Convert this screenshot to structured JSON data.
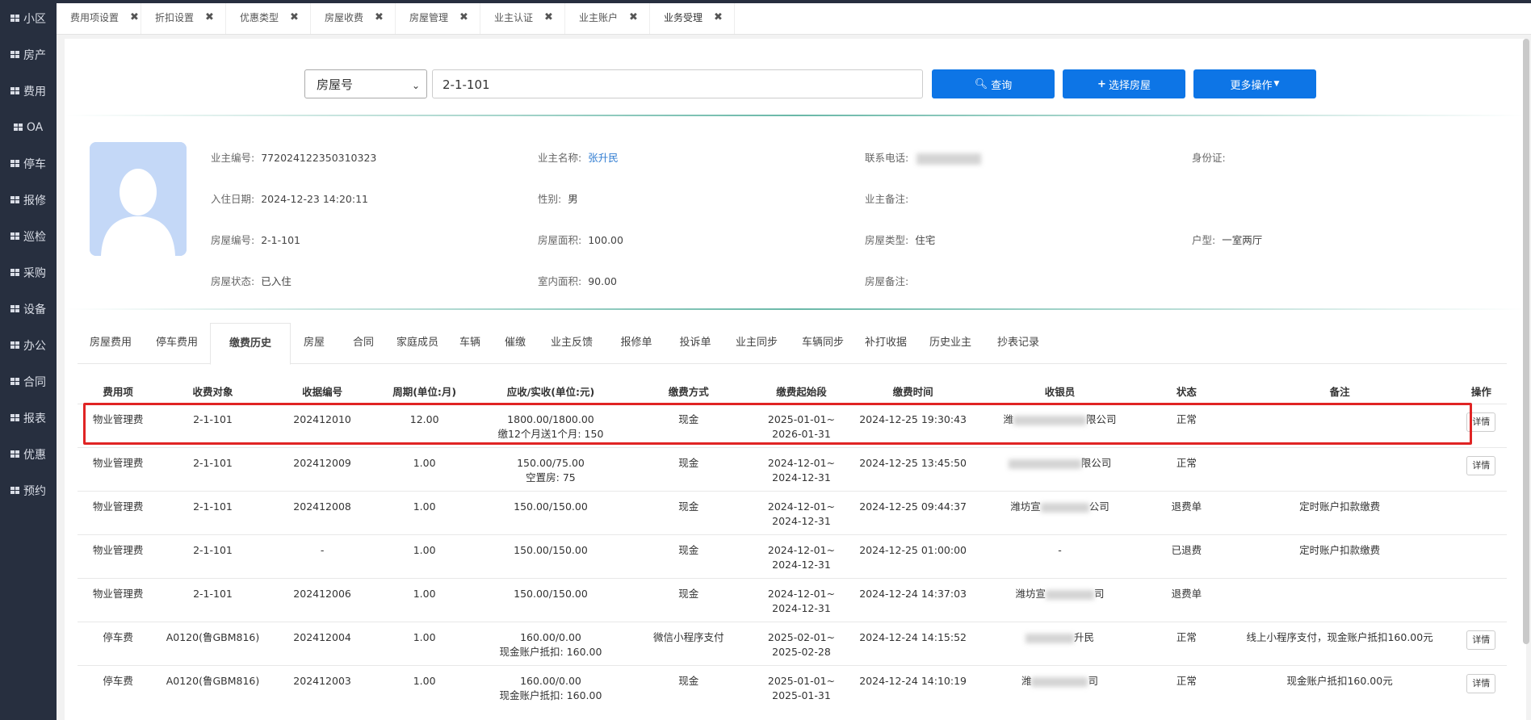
{
  "sidebar": {
    "items": [
      "小区",
      "房产",
      "费用",
      "OA",
      "停车",
      "报修",
      "巡检",
      "采购",
      "设备",
      "办公",
      "合同",
      "报表",
      "优惠",
      "预约"
    ]
  },
  "tabs": [
    {
      "label": "费用项设置"
    },
    {
      "label": "折扣设置"
    },
    {
      "label": "优惠类型"
    },
    {
      "label": "房屋收费"
    },
    {
      "label": "房屋管理"
    },
    {
      "label": "业主认证"
    },
    {
      "label": "业主账户"
    },
    {
      "label": "业务受理"
    }
  ],
  "tab_close": "✖",
  "search": {
    "select_value": "房屋号",
    "input_value": "2-1-101",
    "query_label": "查询",
    "choose_label": "选择房屋",
    "more_label": "更多操作"
  },
  "owner": {
    "code_label": "业主编号:",
    "code": "772024122350310323",
    "name_label": "业主名称:",
    "name": "张升民",
    "phone_label": "联系电话:",
    "id_label": "身份证:",
    "checkin_label": "入住日期:",
    "checkin": "2024-12-23 14:20:11",
    "gender_label": "性别:",
    "gender": "男",
    "remark_label": "业主备注:",
    "house_no_label": "房屋编号:",
    "house_no": "2-1-101",
    "area_label": "房屋面积:",
    "area": "100.00",
    "house_type_label": "房屋类型:",
    "house_type": "住宅",
    "layout_label": "户型:",
    "layout": "一室两厅",
    "status_label": "房屋状态:",
    "status": "已入住",
    "inner_area_label": "室内面积:",
    "inner_area": "90.00",
    "house_remark_label": "房屋备注:"
  },
  "subtabs": [
    "房屋费用",
    "停车费用",
    "缴费历史",
    "房屋",
    "合同",
    "家庭成员",
    "车辆",
    "催缴",
    "业主反馈",
    "报修单",
    "投诉单",
    "业主同步",
    "车辆同步",
    "补打收据",
    "历史业主",
    "抄表记录"
  ],
  "table": {
    "headers": [
      "费用项",
      "收费对象",
      "收据编号",
      "周期(单位:月)",
      "应收/实收(单位:元)",
      "缴费方式",
      "缴费起始段",
      "缴费时间",
      "收银员",
      "状态",
      "备注",
      "操作"
    ],
    "rows": [
      {
        "fee": "物业管理费",
        "target": "2-1-101",
        "receipt": "202412010",
        "period": "12.00",
        "amount": "1800.00/1800.00",
        "amount2": "缴12个月送1个月: 150",
        "method": "现金",
        "range1": "2025-01-01~",
        "range2": "2026-01-31",
        "time": "2024-12-25 19:30:43",
        "cashier_a": "潍",
        "cashier_b": "限公司",
        "status": "正常",
        "remark": "",
        "action": "详情"
      },
      {
        "fee": "物业管理费",
        "target": "2-1-101",
        "receipt": "202412009",
        "period": "1.00",
        "amount": "150.00/75.00",
        "amount2": "空置房: 75",
        "method": "现金",
        "range1": "2024-12-01~",
        "range2": "2024-12-31",
        "time": "2024-12-25 13:45:50",
        "cashier_a": "",
        "cashier_b": "限公司",
        "status": "正常",
        "remark": "",
        "action": "详情"
      },
      {
        "fee": "物业管理费",
        "target": "2-1-101",
        "receipt": "202412008",
        "period": "1.00",
        "amount": "150.00/150.00",
        "amount2": "",
        "method": "现金",
        "range1": "2024-12-01~",
        "range2": "2024-12-31",
        "time": "2024-12-25 09:44:37",
        "cashier_a": "潍坊宣",
        "cashier_b": "公司",
        "status": "退费单",
        "remark": "定时账户扣款缴费",
        "action": ""
      },
      {
        "fee": "物业管理费",
        "target": "2-1-101",
        "receipt": "-",
        "period": "1.00",
        "amount": "150.00/150.00",
        "amount2": "",
        "method": "现金",
        "range1": "2024-12-01~",
        "range2": "2024-12-31",
        "time": "2024-12-25 01:00:00",
        "cashier_a": "-",
        "cashier_b": "",
        "status": "已退费",
        "remark": "定时账户扣款缴费",
        "action": ""
      },
      {
        "fee": "物业管理费",
        "target": "2-1-101",
        "receipt": "202412006",
        "period": "1.00",
        "amount": "150.00/150.00",
        "amount2": "",
        "method": "现金",
        "range1": "2024-12-01~",
        "range2": "2024-12-31",
        "time": "2024-12-24 14:37:03",
        "cashier_a": "潍坊宣",
        "cashier_b": "司",
        "status": "退费单",
        "remark": "",
        "action": ""
      },
      {
        "fee": "停车费",
        "target": "A0120(鲁GBM816)",
        "receipt": "202412004",
        "period": "1.00",
        "amount": "160.00/0.00",
        "amount2": "现金账户抵扣: 160.00",
        "method": "微信小程序支付",
        "range1": "2025-02-01~",
        "range2": "2025-02-28",
        "time": "2024-12-24 14:15:52",
        "cashier_a": "",
        "cashier_b": "升民",
        "status": "正常",
        "remark": "线上小程序支付，现金账户抵扣160.00元",
        "action": "详情"
      },
      {
        "fee": "停车费",
        "target": "A0120(鲁GBM816)",
        "receipt": "202412003",
        "period": "1.00",
        "amount": "160.00/0.00",
        "amount2": "现金账户抵扣: 160.00",
        "method": "现金",
        "range1": "2025-01-01~",
        "range2": "2025-01-31",
        "time": "2024-12-24 14:10:19",
        "cashier_a": "潍",
        "cashier_b": "司",
        "status": "正常",
        "remark": "现金账户抵扣160.00元",
        "action": "详情"
      }
    ]
  }
}
